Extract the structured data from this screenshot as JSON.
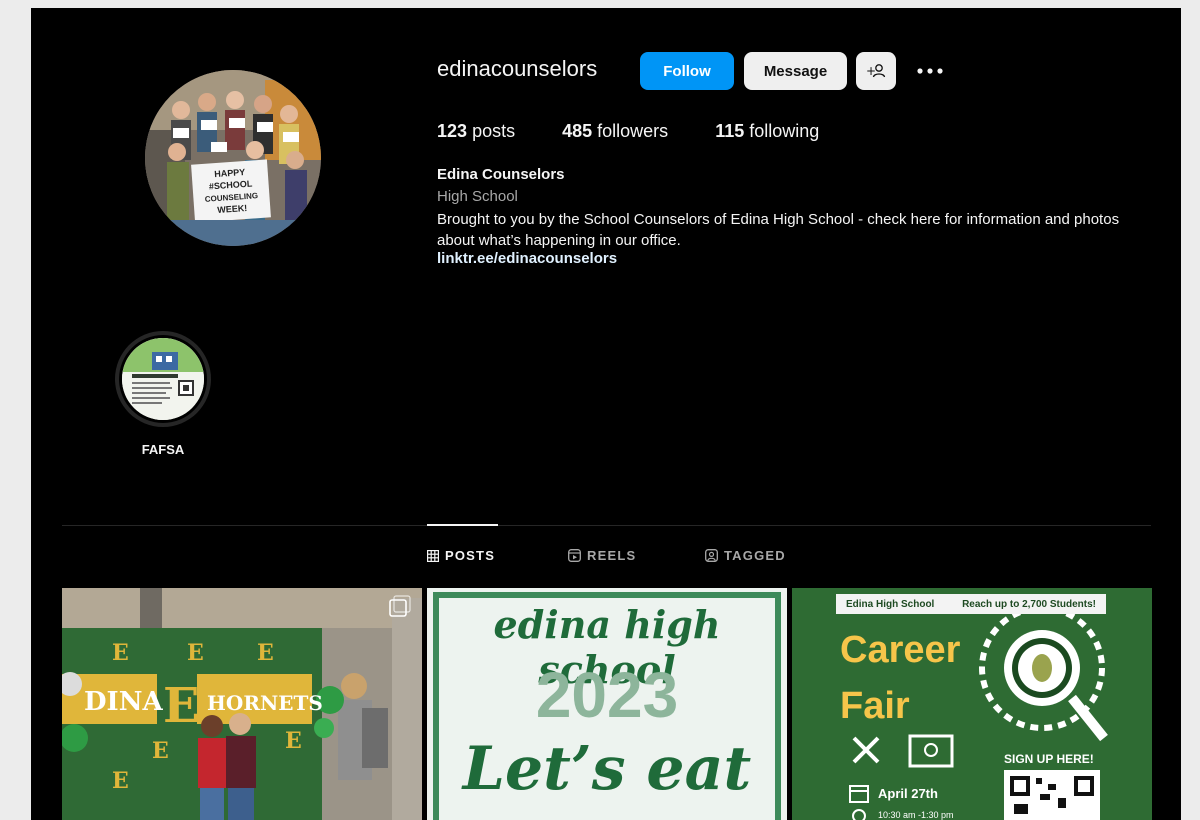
{
  "profile": {
    "username": "edinacounselors",
    "follow_label": "Follow",
    "message_label": "Message",
    "suggest_label": "+♀",
    "more_label": "•••",
    "posts_count": "123",
    "posts_label": "posts",
    "followers_count": "485",
    "followers_label": "followers",
    "following_count": "115",
    "following_label": "following",
    "full_name": "Edina Counselors",
    "category": "High School",
    "bio": "Brought to you by the School Counselors of Edina High School - check here for information and photos about what’s happening in our office.",
    "link": "linktr.ee/edinacounselors",
    "avatar_sign_text": "HAPPY SCHOOL COUNSELING WEEK!"
  },
  "highlights": [
    {
      "label": "FAFSA",
      "cover_text": "Ready, Set, FAFSA!"
    }
  ],
  "tabs": [
    {
      "label": "POSTS",
      "icon": "grid-icon",
      "active": true
    },
    {
      "label": "REELS",
      "icon": "reels-icon",
      "active": false
    },
    {
      "label": "TAGGED",
      "icon": "tagged-icon",
      "active": false
    }
  ],
  "posts": [
    {
      "wall_text": "EDINA",
      "wall_text_2": "HORNETS",
      "letter": "E",
      "badge": "multi-image-icon"
    },
    {
      "line1": "edina high school",
      "line2": "2023",
      "line3": "Let’s eat"
    },
    {
      "banner_left": "Edina High School",
      "banner_right": "Reach up to 2,700 Students!",
      "title_1": "Career",
      "title_2": "Fair",
      "signup": "SIGN UP HERE!",
      "date": "April 27th",
      "time": "10:30 am -1:30 pm"
    }
  ],
  "colors": {
    "background": "#000000",
    "follow_button": "#0095f6",
    "secondary_button": "#efefef",
    "muted_text": "#a8a8a8",
    "link_text": "#e0f1ff"
  }
}
